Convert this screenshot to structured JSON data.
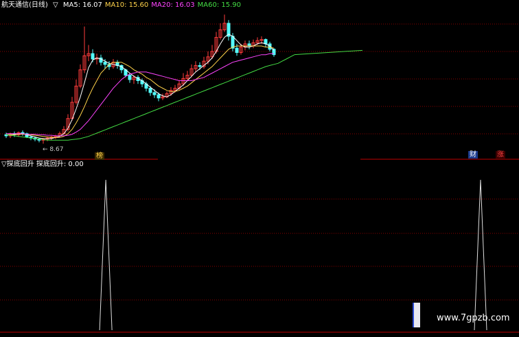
{
  "header": {
    "title": "航天通信(日线)",
    "marker": "▽",
    "ma": [
      {
        "label": "MA5: 16.07",
        "color": "#ffffff"
      },
      {
        "label": "MA10: 15.60",
        "color": "#ffd24a"
      },
      {
        "label": "MA20: 16.03",
        "color": "#ff44ff"
      },
      {
        "label": "MA60: 15.90",
        "color": "#44dd44"
      }
    ]
  },
  "price_panel": {
    "low_label": "← 8.67",
    "badge_left": "榜",
    "badge_cai": "财",
    "badge_zhang": "涨"
  },
  "indicator": {
    "header": "▽探底回升  探底回升: 0.00"
  },
  "watermark": "www.7gpzb.com",
  "colors": {
    "up": "#ff3b3b",
    "down": "#54ffff",
    "ma5": "#ffffff",
    "ma10": "#ffd24a",
    "ma20": "#ff44ff",
    "ma60": "#44dd44",
    "grid": "#8b0000"
  },
  "chart_data": [
    {
      "type": "candlestick",
      "x": [
        0,
        1,
        2,
        3,
        4,
        5,
        6,
        7,
        8,
        9,
        10,
        11,
        12,
        13,
        14,
        15,
        16,
        17,
        18,
        19,
        20,
        21,
        22,
        23,
        24,
        25,
        26,
        27,
        28,
        29,
        30,
        31,
        32,
        33,
        34,
        35,
        36,
        37,
        38,
        39,
        40,
        41,
        42,
        43,
        44,
        45,
        46,
        47,
        48,
        49,
        50,
        51,
        52,
        53,
        54,
        55,
        56,
        57,
        58,
        59,
        60,
        61,
        62,
        63,
        64,
        65,
        66,
        67,
        68,
        69,
        70
      ],
      "open": [
        9.5,
        9.4,
        9.6,
        9.5,
        9.7,
        9.6,
        9.3,
        9.2,
        9.1,
        9.0,
        9.1,
        9.2,
        9.3,
        9.4,
        9.6,
        10.0,
        11.0,
        12.5,
        14.0,
        15.5,
        16.8,
        17.0,
        16.5,
        16.6,
        16.2,
        16.0,
        15.8,
        16.2,
        15.9,
        15.5,
        15.0,
        14.6,
        14.8,
        14.5,
        14.2,
        13.8,
        13.4,
        13.2,
        12.9,
        13.0,
        13.3,
        13.6,
        13.8,
        14.2,
        14.7,
        15.0,
        15.6,
        15.9,
        15.8,
        16.3,
        16.7,
        17.2,
        18.5,
        19.2,
        19.8,
        18.6,
        17.5,
        17.1,
        17.6,
        17.9,
        17.7,
        18.0,
        18.2,
        18.3,
        17.9,
        17.4
      ],
      "close": [
        9.4,
        9.6,
        9.5,
        9.7,
        9.6,
        9.3,
        9.2,
        9.1,
        9.0,
        9.1,
        9.2,
        9.3,
        9.4,
        9.6,
        10.0,
        11.0,
        12.5,
        14.0,
        15.5,
        16.8,
        17.0,
        16.5,
        16.6,
        16.2,
        16.0,
        15.8,
        16.2,
        15.9,
        15.5,
        15.0,
        14.6,
        14.8,
        14.5,
        14.2,
        13.8,
        13.4,
        13.2,
        12.9,
        13.0,
        13.3,
        13.6,
        13.8,
        14.2,
        14.7,
        15.0,
        15.6,
        15.9,
        15.8,
        16.3,
        16.7,
        17.2,
        18.5,
        19.2,
        19.8,
        18.6,
        17.5,
        17.1,
        17.6,
        17.9,
        17.7,
        18.0,
        18.2,
        18.3,
        17.9,
        17.4,
        16.9
      ],
      "high": [
        9.7,
        9.7,
        9.8,
        9.8,
        9.9,
        9.7,
        9.4,
        9.3,
        9.2,
        9.2,
        9.3,
        9.4,
        9.5,
        9.8,
        10.3,
        11.4,
        13.0,
        14.6,
        16.0,
        19.5,
        17.8,
        17.4,
        17.0,
        16.9,
        16.5,
        16.3,
        16.5,
        16.4,
        16.0,
        15.6,
        15.2,
        15.0,
        15.0,
        14.7,
        14.4,
        14.0,
        13.7,
        13.4,
        13.3,
        13.5,
        13.9,
        14.1,
        14.5,
        15.2,
        15.4,
        16.0,
        16.3,
        16.2,
        16.7,
        17.2,
        17.8,
        19.0,
        19.8,
        20.6,
        20.1,
        18.9,
        17.9,
        17.9,
        18.2,
        18.2,
        18.3,
        18.5,
        18.6,
        18.4,
        18.1,
        17.5
      ],
      "low": [
        9.2,
        9.2,
        9.3,
        9.3,
        9.4,
        9.2,
        9.0,
        8.9,
        8.8,
        8.67,
        8.9,
        9.0,
        9.1,
        9.3,
        9.5,
        9.8,
        10.8,
        12.3,
        13.8,
        15.2,
        16.3,
        16.2,
        16.0,
        15.9,
        15.6,
        15.5,
        15.6,
        15.6,
        15.2,
        14.8,
        14.3,
        14.2,
        14.2,
        13.9,
        13.5,
        13.1,
        12.9,
        12.6,
        12.7,
        12.9,
        13.1,
        13.4,
        13.6,
        14.0,
        14.5,
        14.8,
        15.3,
        15.5,
        15.6,
        16.0,
        16.5,
        17.0,
        18.3,
        19.0,
        18.2,
        17.2,
        16.8,
        16.9,
        17.3,
        17.4,
        17.5,
        17.8,
        17.9,
        17.6,
        17.2,
        16.7
      ]
    },
    {
      "type": "line",
      "x": [
        0,
        70
      ],
      "series": [
        {
          "name": "MA5",
          "values": [
            9.5,
            9.5,
            9.55,
            9.6,
            9.6,
            9.5,
            9.4,
            9.3,
            9.2,
            9.15,
            9.12,
            9.15,
            9.25,
            9.35,
            9.6,
            10.1,
            10.9,
            11.9,
            13.0,
            14.3,
            15.7,
            16.4,
            16.6,
            16.5,
            16.3,
            16.1,
            16.0,
            15.9,
            15.8,
            15.5,
            15.2,
            14.9,
            14.7,
            14.5,
            14.2,
            13.9,
            13.6,
            13.3,
            13.1,
            13.0,
            13.2,
            13.5,
            13.8,
            14.1,
            14.5,
            14.9,
            15.3,
            15.6,
            15.9,
            16.2,
            16.6,
            17.2,
            17.9,
            18.5,
            18.8,
            18.6,
            18.2,
            17.8,
            17.6,
            17.6,
            17.7,
            17.9,
            18.0,
            17.9,
            17.7,
            17.3
          ]
        },
        {
          "name": "MA10",
          "values": [
            9.5,
            9.5,
            9.5,
            9.55,
            9.55,
            9.55,
            9.5,
            9.45,
            9.4,
            9.35,
            9.3,
            9.25,
            9.25,
            9.25,
            9.35,
            9.6,
            10.0,
            10.6,
            11.3,
            12.1,
            13.0,
            13.8,
            14.5,
            15.2,
            15.6,
            16.0,
            16.2,
            16.2,
            16.2,
            16.0,
            15.8,
            15.5,
            15.3,
            15.1,
            14.8,
            14.6,
            14.3,
            14.0,
            13.8,
            13.6,
            13.5,
            13.5,
            13.6,
            13.8,
            14.0,
            14.3,
            14.6,
            14.9,
            15.2,
            15.5,
            15.8,
            16.2,
            16.6,
            17.0,
            17.4,
            17.6,
            17.7,
            17.7,
            17.7,
            17.7,
            17.7,
            17.7,
            17.7,
            17.6,
            17.6,
            17.5
          ]
        },
        {
          "name": "MA20",
          "values": [
            9.6,
            9.6,
            9.6,
            9.6,
            9.6,
            9.55,
            9.55,
            9.55,
            9.5,
            9.5,
            9.45,
            9.45,
            9.4,
            9.4,
            9.4,
            9.45,
            9.55,
            9.75,
            10.0,
            10.4,
            10.8,
            11.3,
            11.8,
            12.3,
            12.8,
            13.3,
            13.8,
            14.2,
            14.6,
            14.9,
            15.1,
            15.2,
            15.3,
            15.3,
            15.3,
            15.2,
            15.1,
            15.0,
            14.9,
            14.8,
            14.7,
            14.6,
            14.5,
            14.5,
            14.5,
            14.5,
            14.6,
            14.7,
            14.8,
            15.0,
            15.2,
            15.4,
            15.6,
            15.8,
            16.0,
            16.2,
            16.3,
            16.4,
            16.5,
            16.6,
            16.7,
            16.8,
            16.9,
            16.9,
            17.0,
            17.0
          ]
        },
        {
          "name": "MA60",
          "values": [
            9.5,
            9.45,
            9.4,
            9.35,
            9.3,
            9.25,
            9.2,
            9.15,
            9.1,
            9.05,
            9.0,
            9.0,
            9.0,
            9.0,
            9.0,
            9.0,
            9.05,
            9.1,
            9.15,
            9.25,
            9.35,
            9.5,
            9.65,
            9.8,
            9.95,
            10.1,
            10.25,
            10.4,
            10.55,
            10.7,
            10.85,
            11.0,
            11.15,
            11.3,
            11.45,
            11.6,
            11.75,
            11.9,
            12.05,
            12.2,
            12.35,
            12.5,
            12.65,
            12.8,
            12.95,
            13.1,
            13.25,
            13.4,
            13.55,
            13.7,
            13.85,
            14.0,
            14.15,
            14.3,
            14.45,
            14.6,
            14.75,
            14.9,
            15.05,
            15.2,
            15.35,
            15.5,
            15.65,
            15.8,
            15.9,
            16.0,
            16.1,
            16.3,
            16.5,
            16.7,
            16.9
          ]
        }
      ]
    },
    {
      "type": "line",
      "series": [
        {
          "name": "探底回升",
          "values": [
            0,
            0,
            0,
            0,
            0,
            0,
            0,
            0,
            0,
            0,
            0,
            0,
            0,
            0,
            0,
            0,
            0,
            0,
            0,
            0,
            0,
            0,
            0,
            0,
            0,
            0,
            0,
            0,
            0,
            0,
            0,
            0,
            0,
            0,
            0,
            0,
            0,
            0,
            0,
            0,
            0,
            0,
            0,
            0,
            0,
            0,
            0,
            0,
            0,
            0,
            0,
            0,
            0,
            0,
            0,
            0,
            0,
            0,
            0,
            0,
            0,
            0,
            0,
            0,
            0,
            0,
            0,
            0,
            0,
            0,
            0
          ]
        }
      ],
      "peaks": [
        {
          "bar": 21,
          "value": 1
        },
        {
          "bar": 100,
          "value": 1
        }
      ]
    }
  ]
}
